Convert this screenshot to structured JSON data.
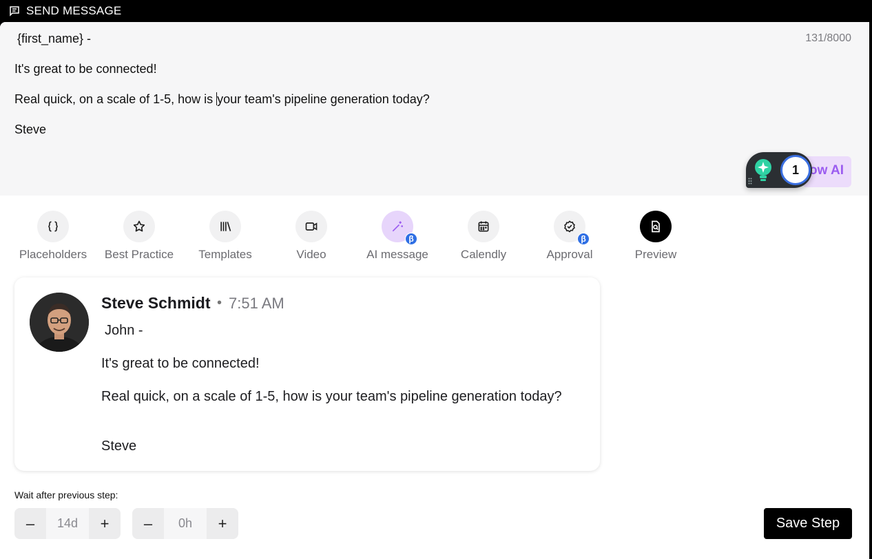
{
  "header": {
    "title": "SEND MESSAGE",
    "icon": "message-square-icon"
  },
  "editor": {
    "lines": [
      "{first_name} -",
      "It's great to be connected!",
      "Real quick, on a scale of 1-5, how is ",
      "your team's pipeline generation today?",
      "Steve"
    ],
    "char_count": "131/8000",
    "ai_pill_label": "ow AI",
    "notification_count": "1"
  },
  "toolbar": {
    "items": [
      {
        "label": "Placeholders",
        "icon": "braces-icon"
      },
      {
        "label": "Best Practice",
        "icon": "star-icon"
      },
      {
        "label": "Templates",
        "icon": "library-icon"
      },
      {
        "label": "Video",
        "icon": "video-camera-icon"
      },
      {
        "label": "AI message",
        "icon": "magic-wand-icon",
        "badge": "β"
      },
      {
        "label": "Calendly",
        "icon": "calendar-icon"
      },
      {
        "label": "Approval",
        "icon": "check-badge-icon",
        "badge": "β"
      },
      {
        "label": "Preview",
        "icon": "preview-doc-icon"
      }
    ]
  },
  "preview": {
    "sender": "Steve Schmidt",
    "separator": "•",
    "time": "7:51 AM",
    "body": [
      "John -",
      "It's great to be connected!",
      "Real quick, on a scale of 1-5, how is your team's pipeline generation today?",
      "Steve"
    ]
  },
  "wait": {
    "label": "Wait after previous step:",
    "days": "14d",
    "hours": "0h",
    "minus": "–",
    "plus": "+"
  },
  "actions": {
    "save_label": "Save Step"
  },
  "colors": {
    "accent_purple": "#9b5cf0",
    "beta_blue": "#2f6fe4",
    "header_bg": "#000000"
  }
}
